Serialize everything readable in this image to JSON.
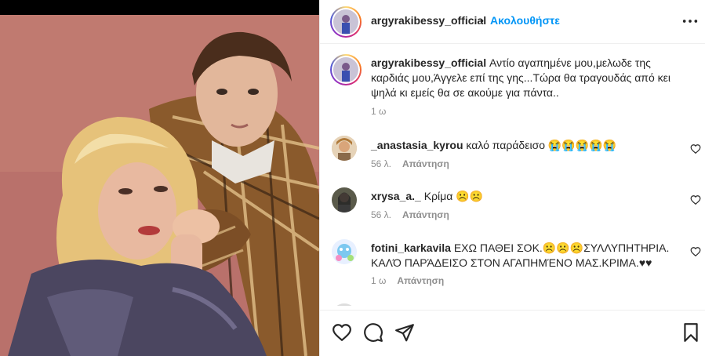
{
  "post": {
    "username": "argyrakibessy_official",
    "dot": "•",
    "follow_label": "Ακολουθήστε",
    "caption": "Αντίο αγαπημένε μου,μελωδε της καρδιάς μου,Άγγελε επί της γης...Τώρα θα τραγουδάς από κει ψηλά κι εμείς θα σε ακούμε για πάντα..",
    "caption_time": "1 ω"
  },
  "comments": [
    {
      "username": "_anastasia_kyrou",
      "text": "καλό παράδεισο 😭😭😭😭😭",
      "time": "56 λ.",
      "reply": "Απάντηση"
    },
    {
      "username": "xrysa_a._",
      "text": "Κρίμα ☹️☹️",
      "time": "56 λ.",
      "reply": "Απάντηση"
    },
    {
      "username": "fotini_karkavila",
      "text": "ΕΧΩ ΠΑΘΕΙ ΣΟΚ.☹️☹️☹️ΣΥΛΛΥΠΗΤΗΡΙΑ. ΚΑΛΌ ΠΑΡΆΔΕΙΣΟ ΣΤΟΝ ΑΓΑΠΗΜΈΝΟ ΜΑΣ.ΚΡΙΜΑ.♥♥",
      "time": "1 ω",
      "reply": "Απάντηση"
    }
  ],
  "icons": {
    "more": "more-options-icon",
    "like": "heart-icon",
    "comment": "comment-icon",
    "share": "paper-plane-icon",
    "save": "bookmark-icon"
  },
  "colors": {
    "link": "#0095f6",
    "muted": "#8e8e8e",
    "text": "#262626"
  }
}
